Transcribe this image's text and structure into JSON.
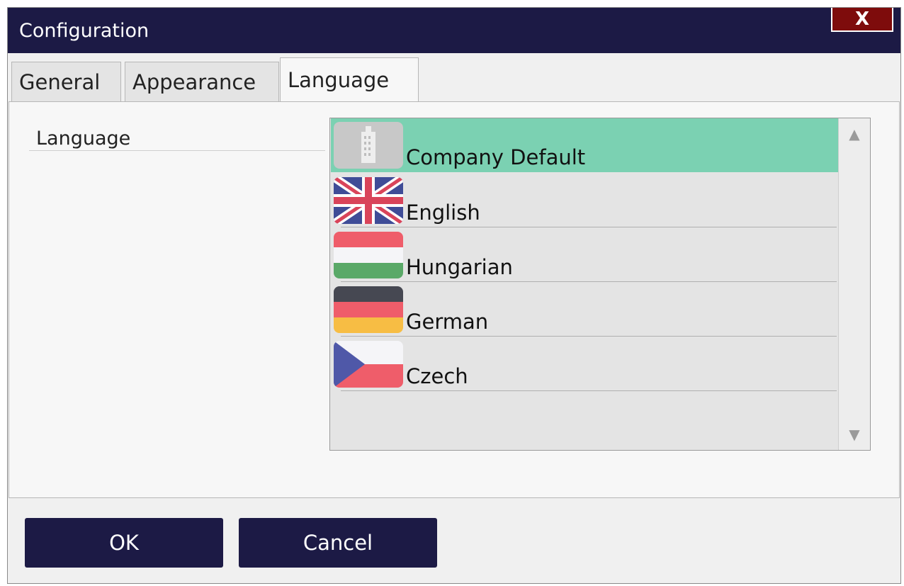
{
  "window": {
    "title": "Configuration",
    "close_label": "X"
  },
  "tabs": [
    {
      "label": "General",
      "active": false
    },
    {
      "label": "Appearance",
      "active": false
    },
    {
      "label": "Language",
      "active": true
    }
  ],
  "language_field": {
    "label": "Language",
    "selected": "Company Default",
    "options": [
      {
        "label": "Company Default",
        "icon": "building-icon",
        "selected": true
      },
      {
        "label": "English",
        "icon": "uk-flag-icon",
        "selected": false
      },
      {
        "label": "Hungarian",
        "icon": "hungary-flag-icon",
        "selected": false
      },
      {
        "label": "German",
        "icon": "germany-flag-icon",
        "selected": false
      },
      {
        "label": "Czech",
        "icon": "czech-flag-icon",
        "selected": false
      }
    ]
  },
  "scrollbar": {
    "up_icon": "scroll-up-arrow-icon",
    "down_icon": "scroll-down-arrow-icon"
  },
  "buttons": {
    "ok_label": "OK",
    "cancel_label": "Cancel"
  },
  "colors": {
    "titlebar": "#1c1a45",
    "close_button": "#7e0c0c",
    "selected_item": "#7bd1b2",
    "button": "#1c1a45"
  }
}
